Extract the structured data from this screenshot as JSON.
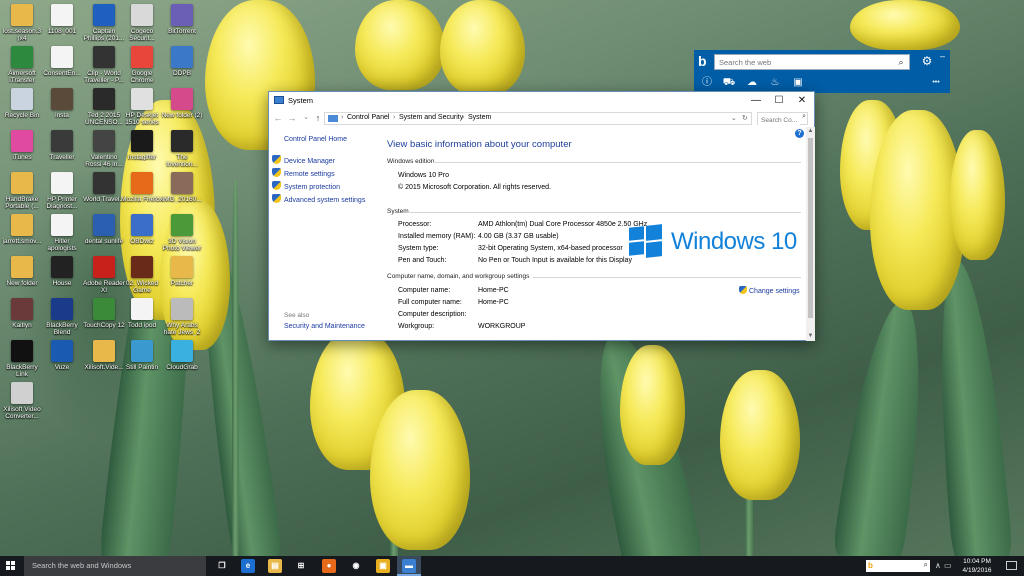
{
  "desktop": {
    "icons": [
      {
        "label": "lost.season.3 (x4",
        "icon": "folder-icon",
        "color": "#e8b84a"
      },
      {
        "label": "1108_001",
        "icon": "document-icon",
        "color": "#f4f4f4"
      },
      {
        "label": "Captain Phillips (201...",
        "icon": "video-icon",
        "color": "#1f5fbf"
      },
      {
        "label": "Cogeco Securit...",
        "icon": "cogeco-icon",
        "color": "#d9d9d9"
      },
      {
        "label": "BitTorrent",
        "icon": "bittorrent-icon",
        "color": "#6a5fb5"
      },
      {
        "label": "Aimersoft iTransfer",
        "icon": "itransfer-icon",
        "color": "#2c8a3e"
      },
      {
        "label": "ConsentEn...",
        "icon": "pdf-document-icon",
        "color": "#f4f4f4"
      },
      {
        "label": "Clip - World Traveller - P...",
        "icon": "video-icon",
        "color": "#333333"
      },
      {
        "label": "Google Chrome",
        "icon": "chrome-icon",
        "color": "#e8463a"
      },
      {
        "label": "DDPB",
        "icon": "ddpb-icon",
        "color": "#3c78c8"
      },
      {
        "label": "Recycle Bin",
        "icon": "recycle-bin-icon",
        "color": "#c9d4e0"
      },
      {
        "label": "insta",
        "icon": "image-icon",
        "color": "#5a4a3a"
      },
      {
        "label": "Ted 2 2015 UNCENSO...",
        "icon": "video-icon",
        "color": "#2a2a2a"
      },
      {
        "label": "HP Deskjet 1510 series",
        "icon": "printer-icon",
        "color": "#e0e0e0"
      },
      {
        "label": "New folder (2)",
        "icon": "folder-icon",
        "color": "#d44a8a"
      },
      {
        "label": "iTunes",
        "icon": "itunes-icon",
        "color": "#e04aa0"
      },
      {
        "label": "Traveller",
        "icon": "video-icon",
        "color": "#3a3a3a"
      },
      {
        "label": "Valentino Rossi 46 in...",
        "icon": "video-icon",
        "color": "#444444"
      },
      {
        "label": "Instagiffer",
        "icon": "instagiffer-icon",
        "color": "#1a1a1a"
      },
      {
        "label": "The Invention...",
        "icon": "video-icon",
        "color": "#2a2a2a"
      },
      {
        "label": "HandBrake Portable (...",
        "icon": "folder-icon",
        "color": "#e8b84a"
      },
      {
        "label": "HP Printer Diagnost...",
        "icon": "document-icon",
        "color": "#f4f4f4"
      },
      {
        "label": "World Travel...",
        "icon": "video-icon",
        "color": "#333333"
      },
      {
        "label": "Mozilla Firefox",
        "icon": "firefox-icon",
        "color": "#e66a1a"
      },
      {
        "label": "IMG_20160...",
        "icon": "image-icon",
        "color": "#8a6a5a"
      },
      {
        "label": "jarrett.smov...",
        "icon": "folder-icon",
        "color": "#e8b84a"
      },
      {
        "label": "Hitler apologists",
        "icon": "document-icon",
        "color": "#f4f4f4"
      },
      {
        "label": "dental sunlife",
        "icon": "word-document-icon",
        "color": "#2b5fb0"
      },
      {
        "label": "OBDwiz",
        "icon": "obdwiz-icon",
        "color": "#3a6ec8"
      },
      {
        "label": "3D Vision Photo Viewer",
        "icon": "3d-vision-icon",
        "color": "#4a9a3a"
      },
      {
        "label": "New folder",
        "icon": "folder-icon",
        "color": "#e8b84a"
      },
      {
        "label": "House",
        "icon": "video-icon",
        "color": "#222222"
      },
      {
        "label": "Adobe Reader XI",
        "icon": "adobe-reader-icon",
        "color": "#c8201a"
      },
      {
        "label": "02. Wicked Game",
        "icon": "music-icon",
        "color": "#6a2a1a"
      },
      {
        "label": "Patcher",
        "icon": "folder-icon",
        "color": "#e8b84a"
      },
      {
        "label": "Kaitlyn",
        "icon": "image-icon",
        "color": "#6a3a3a"
      },
      {
        "label": "BlackBerry Blend",
        "icon": "blackberry-blend-icon",
        "color": "#1a3a8a"
      },
      {
        "label": "TouchCopy 12",
        "icon": "touchcopy-icon",
        "color": "#3a8a3a"
      },
      {
        "label": "Todd ipod",
        "icon": "document-icon",
        "color": "#f4f4f4"
      },
      {
        "label": "Why Arabs hate Jews_2",
        "icon": "document-icon",
        "color": "#bbbbbb"
      },
      {
        "label": "BlackBerry Link",
        "icon": "blackberry-link-icon",
        "color": "#111111"
      },
      {
        "label": "Vuze",
        "icon": "vuze-icon",
        "color": "#1a5ab0"
      },
      {
        "label": "Xilisoft.Vide...",
        "icon": "folder-icon",
        "color": "#e8b84a"
      },
      {
        "label": "Still Paintin",
        "icon": "disc-icon",
        "color": "#3a9ad0"
      },
      {
        "label": "CloudGrab",
        "icon": "cloudgrab-icon",
        "color": "#3ab0e0"
      },
      {
        "label": "Xilisoft Video Converter...",
        "icon": "film-reel-icon",
        "color": "#d0d0d0"
      }
    ]
  },
  "bing": {
    "logo": "b",
    "search_placeholder": "Search the web",
    "search_button": "⌕",
    "gear": "⚙",
    "minimize": "–",
    "more": "•••",
    "tools": [
      "ⓘ",
      "⛟",
      "☁",
      "♨",
      "▣"
    ]
  },
  "window": {
    "title": "System",
    "controls": {
      "minimize": "—",
      "maximize": "☐",
      "close": "✕"
    },
    "nav": {
      "back": "←",
      "forward": "→",
      "dropdown": "⌄",
      "up": "↑",
      "refresh": "↻"
    },
    "breadcrumb": [
      "Control Panel",
      "System and Security",
      "System"
    ],
    "search_placeholder": "Search Co...",
    "left_pane": {
      "home": "Control Panel Home",
      "links": [
        "Device Manager",
        "Remote settings",
        "System protection",
        "Advanced system settings"
      ],
      "see_also": "See also",
      "security": "Security and Maintenance"
    },
    "content": {
      "heading": "View basic information about your computer",
      "edition_section": "Windows edition",
      "edition": "Windows 10 Pro",
      "copyright": "© 2015 Microsoft Corporation. All rights reserved.",
      "logo_text": "Windows 10",
      "system_section": "System",
      "system_rows": [
        {
          "key": "Processor:",
          "value": "AMD Athlon(tm) Dual Core Processor 4850e   2.50 GHz"
        },
        {
          "key": "Installed memory (RAM):",
          "value": "4.00 GB (3.37 GB usable)"
        },
        {
          "key": "System type:",
          "value": "32-bit Operating System, x64-based processor"
        },
        {
          "key": "Pen and Touch:",
          "value": "No Pen or Touch Input is available for this Display"
        }
      ],
      "computer_section": "Computer name, domain, and workgroup settings",
      "computer_rows": [
        {
          "key": "Computer name:",
          "value": "Home-PC"
        },
        {
          "key": "Full computer name:",
          "value": "Home-PC"
        },
        {
          "key": "Computer description:",
          "value": ""
        },
        {
          "key": "Workgroup:",
          "value": "WORKGROUP"
        }
      ],
      "change_settings": "Change settings",
      "help": "?"
    }
  },
  "taskbar": {
    "search_placeholder": "Search the web and Windows",
    "apps": [
      {
        "name": "task-view-icon",
        "glyph": "❐",
        "color": "#16191e"
      },
      {
        "name": "edge-icon",
        "glyph": "e",
        "color": "#1c6fd1"
      },
      {
        "name": "file-explorer-icon",
        "glyph": "▤",
        "color": "#e8b84a"
      },
      {
        "name": "store-icon",
        "glyph": "⊞",
        "color": "#16191e"
      },
      {
        "name": "firefox-icon",
        "glyph": "●",
        "color": "#e66a1a"
      },
      {
        "name": "webcam-icon",
        "glyph": "◉",
        "color": "#16191e"
      },
      {
        "name": "app-icon",
        "glyph": "▣",
        "color": "#e8b020"
      },
      {
        "name": "system-window-icon",
        "glyph": "▬",
        "color": "#3a7fd0"
      }
    ],
    "bing_glyph": "b",
    "bing_search": "⌕",
    "tray": [
      "∧",
      "▭",
      "♪",
      "⌨"
    ],
    "time": "10:04 PM",
    "date": "4/19/2016"
  }
}
